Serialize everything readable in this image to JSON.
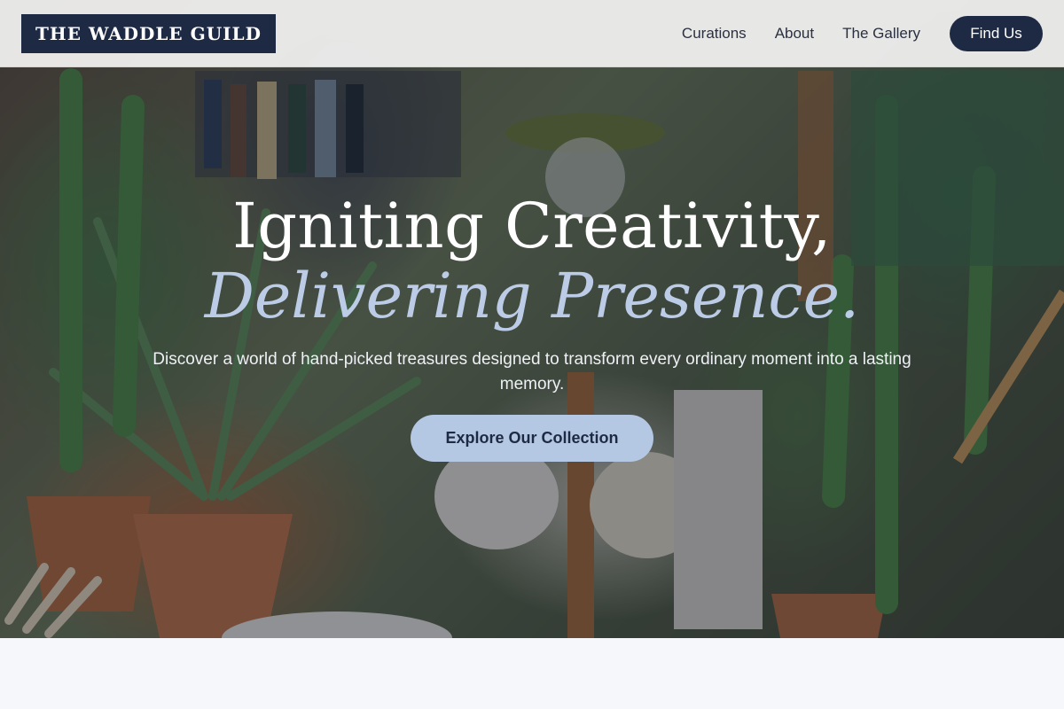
{
  "brand": {
    "name": "THE WADDLE GUILD"
  },
  "nav": {
    "links": [
      "Curations",
      "About",
      "The Gallery"
    ],
    "cta_label": "Find Us"
  },
  "hero": {
    "headline_line1": "Igniting Creativity,",
    "headline_line2": "Delivering Presence.",
    "subtitle": "Discover a world of hand-picked treasures designed to transform every ordinary moment into a lasting memory.",
    "cta_label": "Explore Our Collection"
  },
  "colors": {
    "navy": "#1e2a44",
    "accent_blue": "#b4c8e4",
    "page_background": "#f6f7fb"
  }
}
